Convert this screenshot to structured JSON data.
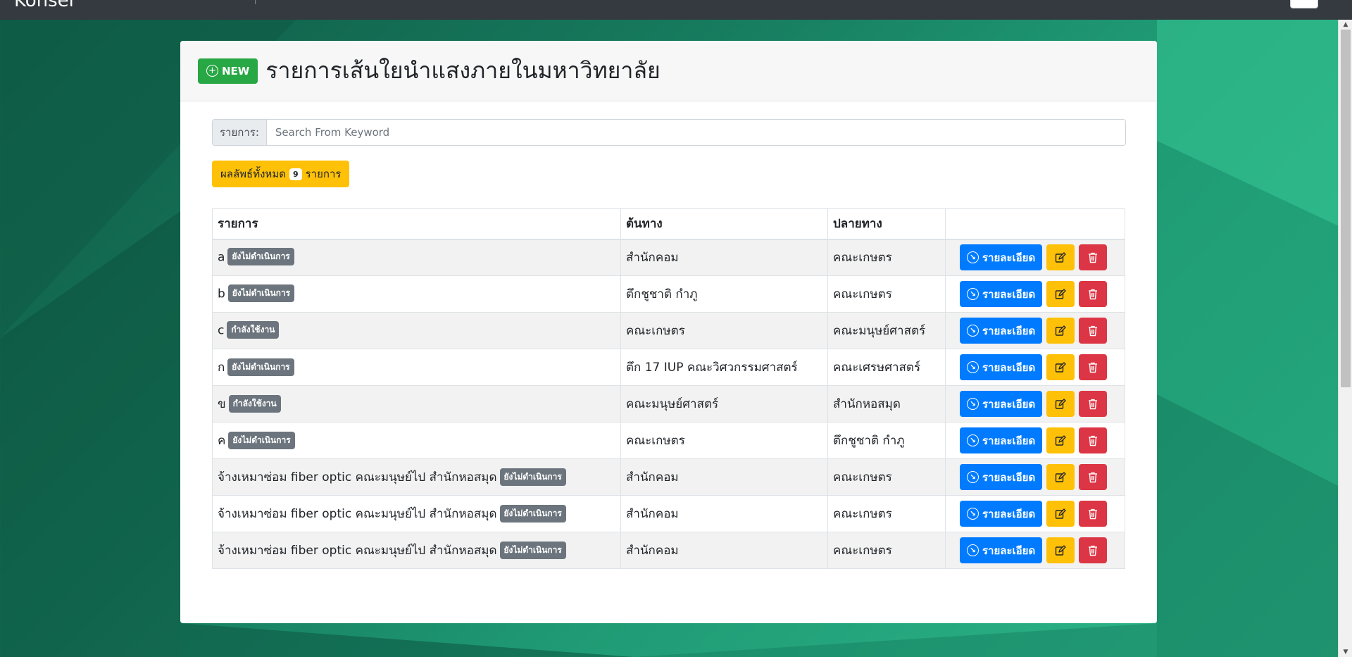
{
  "app": {
    "brand": "Kohsel"
  },
  "header": {
    "new_label": "NEW",
    "title": "รายการเส้นใยนำแสงภายในมหาวิทยาลัย"
  },
  "search": {
    "label": "รายการ:",
    "placeholder": "Search From Keyword",
    "value": ""
  },
  "result": {
    "prefix": "ผลลัพธ์ทั้งหมด",
    "count": "9",
    "suffix": "รายการ"
  },
  "table": {
    "headers": [
      "รายการ",
      "ต้นทาง",
      "ปลายทาง",
      ""
    ],
    "detail_label": "รายละเอียด",
    "rows": [
      {
        "name": "a",
        "status": "ยังไม่ดำเนินการ",
        "source": "สำนักคอม",
        "destination": "คณะเกษตร"
      },
      {
        "name": "b",
        "status": "ยังไม่ดำเนินการ",
        "source": "ตึกชูชาติ กำภู",
        "destination": "คณะเกษตร"
      },
      {
        "name": "c",
        "status": "กำลังใช้งาน",
        "source": "คณะเกษตร",
        "destination": "คณะมนุษย์ศาสตร์"
      },
      {
        "name": "ก",
        "status": "ยังไม่ดำเนินการ",
        "source": "ตึก 17 IUP คณะวิศวกรรมศาสตร์",
        "destination": "คณะเศรษศาสตร์"
      },
      {
        "name": "ข",
        "status": "กำลังใช้งาน",
        "source": "คณะมนุษย์ศาสตร์",
        "destination": "สำนักหอสมุด"
      },
      {
        "name": "ค",
        "status": "ยังไม่ดำเนินการ",
        "source": "คณะเกษตร",
        "destination": "ตึกชูชาติ กำภู"
      },
      {
        "name": "จ้างเหมาซ่อม fiber optic คณะมนุษย์ไป สำนักหอสมุด",
        "status": "ยังไม่ดำเนินการ",
        "source": "สำนักคอม",
        "destination": "คณะเกษตร"
      },
      {
        "name": "จ้างเหมาซ่อม fiber optic คณะมนุษย์ไป สำนักหอสมุด",
        "status": "ยังไม่ดำเนินการ",
        "source": "สำนักคอม",
        "destination": "คณะเกษตร"
      },
      {
        "name": "จ้างเหมาซ่อม fiber optic คณะมนุษย์ไป สำนักหอสมุด",
        "status": "ยังไม่ดำเนินการ",
        "source": "สำนักคอม",
        "destination": "คณะเกษตร"
      }
    ]
  },
  "colors": {
    "new_button": "#28a745",
    "detail_button": "#007bff",
    "edit_button": "#ffc107",
    "delete_button": "#dc3545",
    "status_badge": "#6c757d",
    "navbar": "#343a40"
  }
}
